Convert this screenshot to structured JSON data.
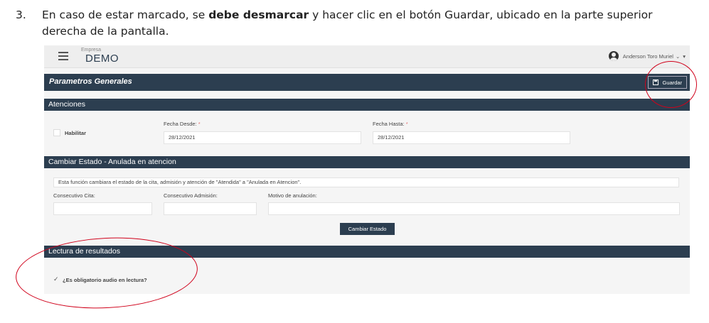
{
  "instruction": {
    "number": "3.",
    "part1": "En caso de estar marcado, se ",
    "bold": "debe desmarcar",
    "part2": " y hacer clic en el botón Guardar, ubicado en la parte superior derecha de la pantalla."
  },
  "topbar": {
    "brand_small": "Empresa",
    "brand": "DEMO",
    "user_name": "Anderson Toro Muriel",
    "user_chevron": "⌄",
    "user_caret": "▾"
  },
  "page": {
    "title": "Parametros Generales",
    "save_label": "Guardar"
  },
  "atenciones": {
    "header": "Atenciones",
    "habilitar_label": "Habilitar",
    "fecha_desde_label": "Fecha Desde:",
    "fecha_desde_value": "28/12/2021",
    "fecha_hasta_label": "Fecha Hasta:",
    "fecha_hasta_value": "28/12/2021",
    "required_mark": "*"
  },
  "cambiar_estado": {
    "header": "Cambiar Estado - Anulada en atencion",
    "info_text": "Esta función cambiara el estado de la cita, admisión y atención de \"Atendida\" a \"Anulada en Atencion\".",
    "consecutivo_cita_label": "Consecutivo Cita:",
    "consecutivo_admision_label": "Consecutivo Admisión:",
    "motivo_label": "Motivo de anulación:",
    "button_label": "Cambiar Estado"
  },
  "lectura": {
    "header": "Lectura de resultados",
    "checkbox_label": "¿Es obligatorio audio en lectura?",
    "check_glyph": "✓"
  },
  "colors": {
    "header_bg": "#2c3e50",
    "annotation": "#d0021b"
  }
}
